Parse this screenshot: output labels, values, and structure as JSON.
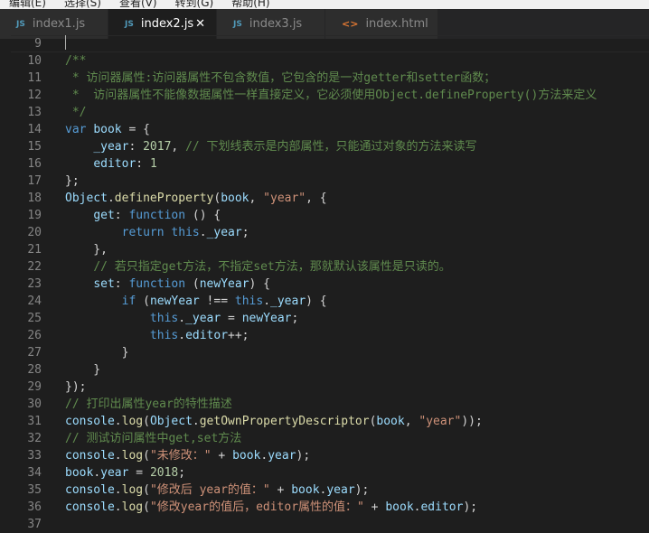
{
  "menu": [
    "编辑(E)",
    "选择(S)",
    "查看(V)",
    "转到(G)",
    "帮助(H)"
  ],
  "tabs": [
    {
      "label": "index1.js",
      "icon": "JS",
      "active": false
    },
    {
      "label": "index2.js",
      "icon": "JS",
      "active": true,
      "close": "✕"
    },
    {
      "label": "index3.js",
      "icon": "JS",
      "active": false
    },
    {
      "label": "index.html",
      "icon": "<>",
      "active": false
    }
  ],
  "colors": {
    "background": "#1e1e1e",
    "keyword": "#569cd6",
    "string": "#ce9178",
    "comment": "#608b4e",
    "number": "#b5cea8",
    "identifier": "#9cdcfe",
    "function": "#dcdcaa"
  },
  "lines": [
    {
      "n": "9",
      "t": []
    },
    {
      "n": "10",
      "t": [
        [
          "cm",
          "/**"
        ]
      ]
    },
    {
      "n": "11",
      "t": [
        [
          "cm",
          " * 访问器属性:访问器属性不包含数值，它包含的是一对getter和setter函数；"
        ]
      ]
    },
    {
      "n": "12",
      "t": [
        [
          "cm",
          " *  访问器属性不能像数据属性一样直接定义，它必须使用Object.defineProperty()方法来定义"
        ]
      ]
    },
    {
      "n": "13",
      "t": [
        [
          "cm",
          " */"
        ]
      ]
    },
    {
      "n": "14",
      "t": [
        [
          "kw",
          "var"
        ],
        [
          "pl",
          " "
        ],
        [
          "id",
          "book"
        ],
        [
          "pl",
          " = {"
        ]
      ]
    },
    {
      "n": "15",
      "t": [
        [
          "pl",
          "    "
        ],
        [
          "id",
          "_year"
        ],
        [
          "pl",
          ": "
        ],
        [
          "num",
          "2017"
        ],
        [
          "pl",
          ", "
        ],
        [
          "cm",
          "// 下划线表示是内部属性，只能通过对象的方法来读写"
        ]
      ]
    },
    {
      "n": "16",
      "t": [
        [
          "pl",
          "    "
        ],
        [
          "id",
          "editor"
        ],
        [
          "pl",
          ": "
        ],
        [
          "num",
          "1"
        ]
      ]
    },
    {
      "n": "17",
      "t": [
        [
          "pl",
          "};"
        ]
      ]
    },
    {
      "n": "18",
      "t": [
        [
          "cls",
          "Object"
        ],
        [
          "pl",
          "."
        ],
        [
          "fn",
          "defineProperty"
        ],
        [
          "pl",
          "("
        ],
        [
          "id",
          "book"
        ],
        [
          "pl",
          ", "
        ],
        [
          "str",
          "\"year\""
        ],
        [
          "pl",
          ", {"
        ]
      ]
    },
    {
      "n": "19",
      "t": [
        [
          "pl",
          "    "
        ],
        [
          "id",
          "get"
        ],
        [
          "pl",
          ": "
        ],
        [
          "kw",
          "function"
        ],
        [
          "pl",
          " () {"
        ]
      ]
    },
    {
      "n": "20",
      "t": [
        [
          "pl",
          "        "
        ],
        [
          "kw",
          "return"
        ],
        [
          "pl",
          " "
        ],
        [
          "kw",
          "this"
        ],
        [
          "pl",
          "."
        ],
        [
          "id",
          "_year"
        ],
        [
          "pl",
          ";"
        ]
      ]
    },
    {
      "n": "21",
      "t": [
        [
          "pl",
          "    },"
        ]
      ]
    },
    {
      "n": "22",
      "t": [
        [
          "pl",
          "    "
        ],
        [
          "cm",
          "// 若只指定get方法，不指定set方法，那就默认该属性是只读的。"
        ]
      ]
    },
    {
      "n": "23",
      "t": [
        [
          "pl",
          "    "
        ],
        [
          "id",
          "set"
        ],
        [
          "pl",
          ": "
        ],
        [
          "kw",
          "function"
        ],
        [
          "pl",
          " ("
        ],
        [
          "id",
          "newYear"
        ],
        [
          "pl",
          ") {"
        ]
      ]
    },
    {
      "n": "24",
      "t": [
        [
          "pl",
          "        "
        ],
        [
          "kw",
          "if"
        ],
        [
          "pl",
          " ("
        ],
        [
          "id",
          "newYear"
        ],
        [
          "pl",
          " !== "
        ],
        [
          "kw",
          "this"
        ],
        [
          "pl",
          "."
        ],
        [
          "id",
          "_year"
        ],
        [
          "pl",
          ") {"
        ]
      ]
    },
    {
      "n": "25",
      "t": [
        [
          "pl",
          "            "
        ],
        [
          "kw",
          "this"
        ],
        [
          "pl",
          "."
        ],
        [
          "id",
          "_year"
        ],
        [
          "pl",
          " = "
        ],
        [
          "id",
          "newYear"
        ],
        [
          "pl",
          ";"
        ]
      ]
    },
    {
      "n": "26",
      "t": [
        [
          "pl",
          "            "
        ],
        [
          "kw",
          "this"
        ],
        [
          "pl",
          "."
        ],
        [
          "id",
          "editor"
        ],
        [
          "pl",
          "++;"
        ]
      ]
    },
    {
      "n": "27",
      "t": [
        [
          "pl",
          "        }"
        ]
      ]
    },
    {
      "n": "28",
      "t": [
        [
          "pl",
          "    }"
        ]
      ]
    },
    {
      "n": "29",
      "t": [
        [
          "pl",
          "});"
        ]
      ]
    },
    {
      "n": "30",
      "t": [
        [
          "cm",
          "// 打印出属性year的特性描述"
        ]
      ]
    },
    {
      "n": "31",
      "t": [
        [
          "id",
          "console"
        ],
        [
          "pl",
          "."
        ],
        [
          "fn",
          "log"
        ],
        [
          "pl",
          "("
        ],
        [
          "cls",
          "Object"
        ],
        [
          "pl",
          "."
        ],
        [
          "fn",
          "getOwnPropertyDescriptor"
        ],
        [
          "pl",
          "("
        ],
        [
          "id",
          "book"
        ],
        [
          "pl",
          ", "
        ],
        [
          "str",
          "\"year\""
        ],
        [
          "pl",
          "));"
        ]
      ]
    },
    {
      "n": "32",
      "t": [
        [
          "cm",
          "// 测试访问属性中get,set方法"
        ]
      ]
    },
    {
      "n": "33",
      "t": [
        [
          "id",
          "console"
        ],
        [
          "pl",
          "."
        ],
        [
          "fn",
          "log"
        ],
        [
          "pl",
          "("
        ],
        [
          "str",
          "\"未修改：\""
        ],
        [
          "pl",
          " + "
        ],
        [
          "id",
          "book"
        ],
        [
          "pl",
          "."
        ],
        [
          "id",
          "year"
        ],
        [
          "pl",
          ");"
        ]
      ]
    },
    {
      "n": "34",
      "t": [
        [
          "id",
          "book"
        ],
        [
          "pl",
          "."
        ],
        [
          "id",
          "year"
        ],
        [
          "pl",
          " = "
        ],
        [
          "num",
          "2018"
        ],
        [
          "pl",
          ";"
        ]
      ]
    },
    {
      "n": "35",
      "t": [
        [
          "id",
          "console"
        ],
        [
          "pl",
          "."
        ],
        [
          "fn",
          "log"
        ],
        [
          "pl",
          "("
        ],
        [
          "str",
          "\"修改后 year的值：\""
        ],
        [
          "pl",
          " + "
        ],
        [
          "id",
          "book"
        ],
        [
          "pl",
          "."
        ],
        [
          "id",
          "year"
        ],
        [
          "pl",
          ");"
        ]
      ]
    },
    {
      "n": "36",
      "t": [
        [
          "id",
          "console"
        ],
        [
          "pl",
          "."
        ],
        [
          "fn",
          "log"
        ],
        [
          "pl",
          "("
        ],
        [
          "str",
          "\"修改year的值后，editor属性的值：\""
        ],
        [
          "pl",
          " + "
        ],
        [
          "id",
          "book"
        ],
        [
          "pl",
          "."
        ],
        [
          "id",
          "editor"
        ],
        [
          "pl",
          ");"
        ]
      ]
    },
    {
      "n": "37",
      "t": []
    }
  ]
}
